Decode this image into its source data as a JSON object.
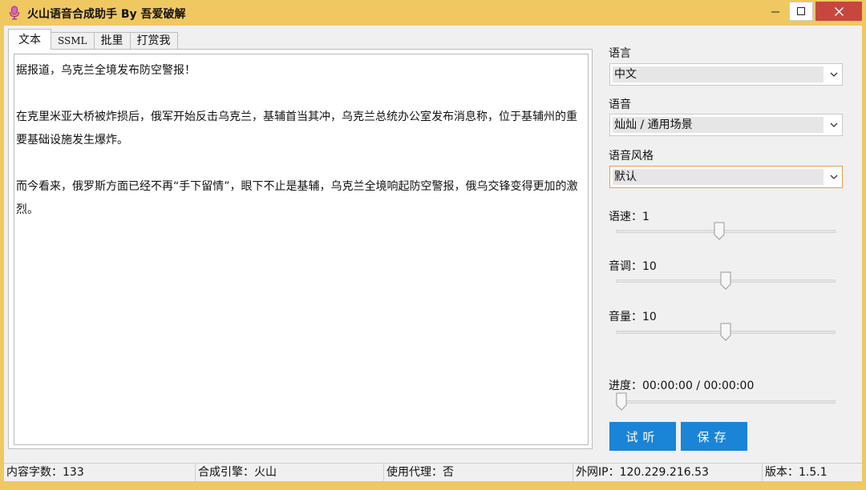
{
  "window": {
    "title": "火山语音合成助手 By 吾爱破解",
    "accent": "#f0c861"
  },
  "tabs": [
    {
      "label": "文本"
    },
    {
      "label": "SSML"
    },
    {
      "label": "批里"
    },
    {
      "label": "打赏我"
    }
  ],
  "editor": {
    "paragraphs": [
      "据报道，乌克兰全境发布防空警报！",
      "在克里米亚大桥被炸损后，俄军开始反击乌克兰，基辅首当其冲，乌克兰总统办公室发布消息称，位于基辅州的重要基础设施发生爆炸。",
      "而今看来，俄罗斯方面已经不再“手下留情”，眼下不止是基辅，乌克兰全境响起防空警报，俄乌交锋变得更加的激烈。"
    ]
  },
  "settings": {
    "language_label": "语言",
    "language_value": "中文",
    "voice_label": "语音",
    "voice_value": "灿灿 / 通用场景",
    "style_label": "语音风格",
    "style_value": "默认",
    "speed_label": "语速：1",
    "speed_level": 0.47,
    "pitch_label": "音调：10",
    "pitch_level": 0.5,
    "volume_label": "音量：10",
    "volume_level": 0.5,
    "progress_label": "进度：00:00:00 / 00:00:00",
    "progress_level": 0
  },
  "buttons": {
    "preview": "试听",
    "save": "保存",
    "color": "#1a84d6"
  },
  "status": {
    "char_count": "内容字数：133",
    "engine": "合成引擎：火山",
    "proxy": "使用代理：否",
    "ip": "外网IP：120.229.216.53",
    "version": "版本：1.5.1"
  }
}
